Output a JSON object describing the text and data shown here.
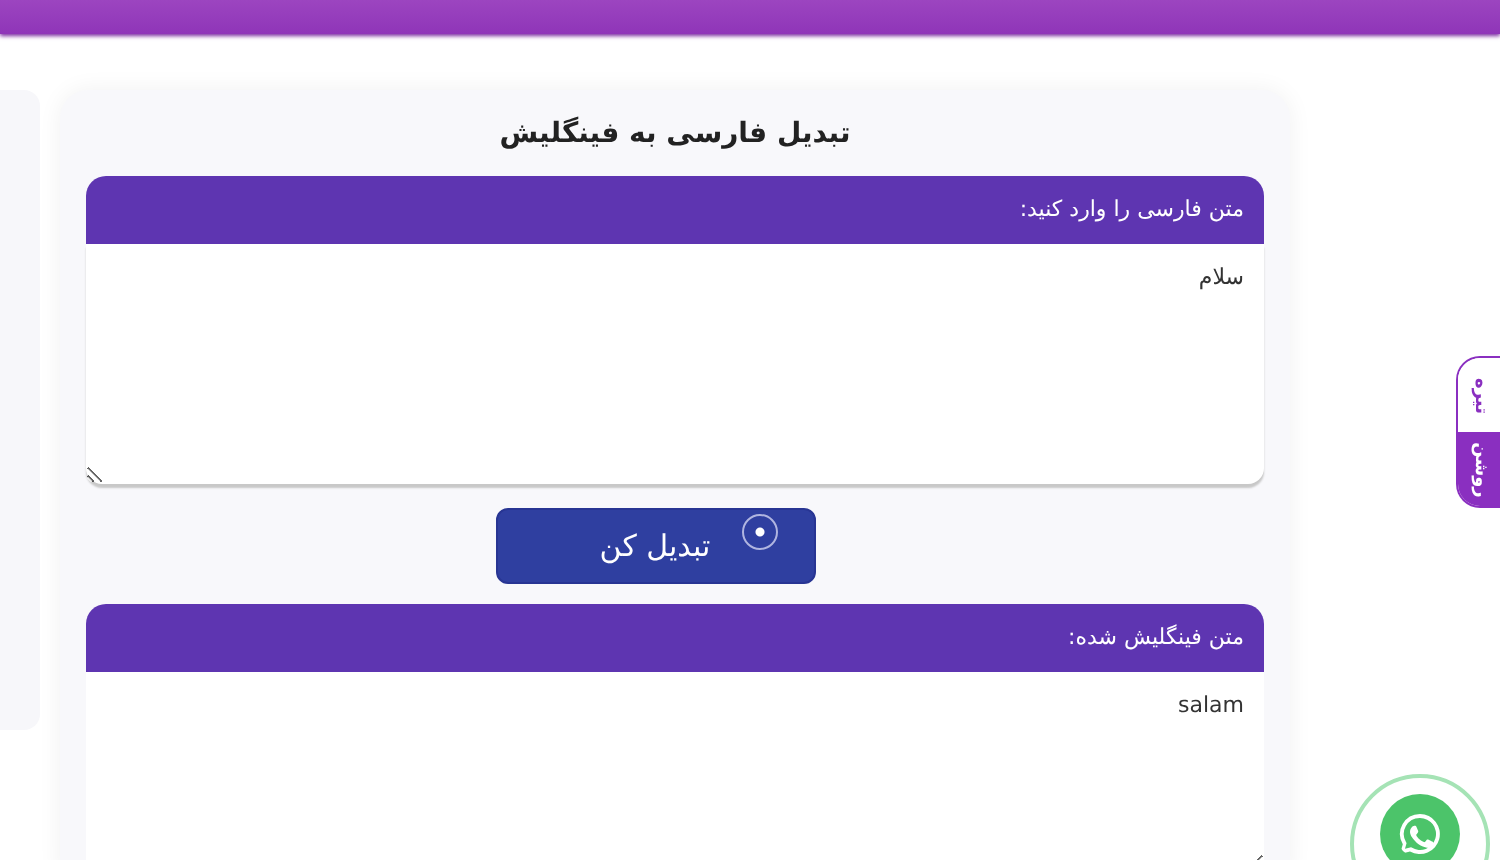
{
  "title": "تبدیل فارسی به فینگلیش",
  "input": {
    "label": "متن فارسی را وارد کنید:",
    "value": "سلام"
  },
  "convert_button": {
    "label": "تبدیل کن"
  },
  "output": {
    "label": "متن فینگلیش شده:",
    "value": "salam"
  },
  "theme_toggle": [
    {
      "label": "تیره",
      "selected": false
    },
    {
      "label": "روشن",
      "selected": true
    }
  ]
}
